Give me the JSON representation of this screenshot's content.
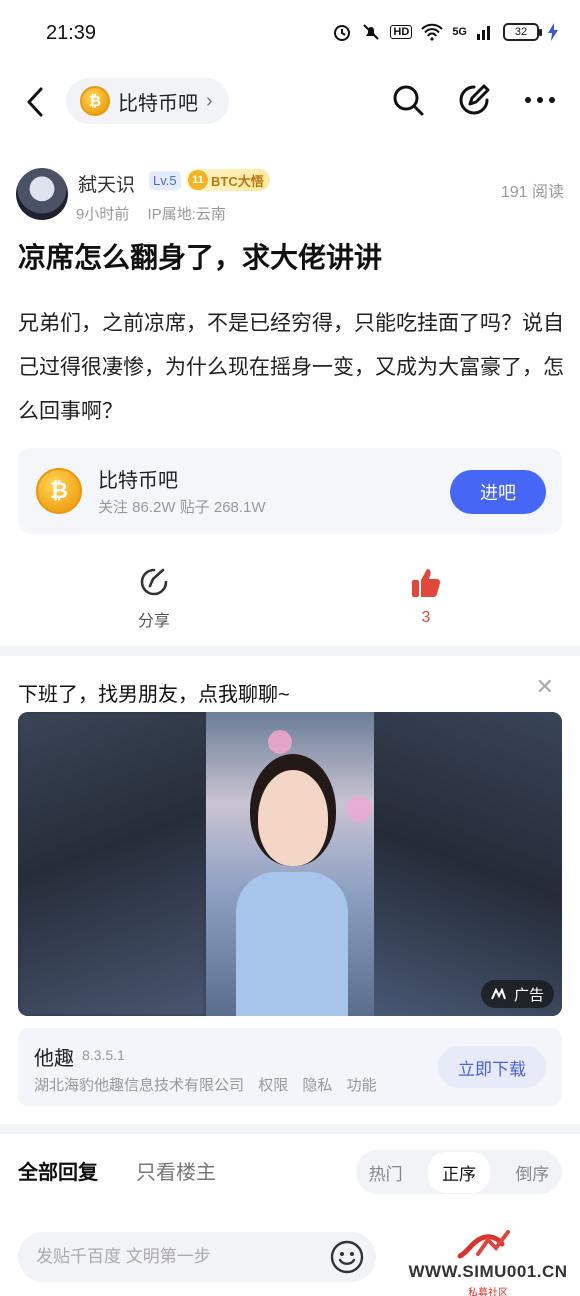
{
  "status_bar": {
    "time": "21:39",
    "network": "5G",
    "battery": "32",
    "hd": "HD"
  },
  "nav": {
    "forum_name": "比特币吧",
    "coin_symbol": "₿"
  },
  "post": {
    "author": "弑天识",
    "level": "Lv.5",
    "badge_number": "11",
    "badge_label": "BTC大悟",
    "time_ago": "9小时前",
    "ip_location": "IP属地:云南",
    "read_count": "191 阅读",
    "title": "凉席怎么翻身了，求大佬讲讲",
    "body": "兄弟们，之前凉席，不是已经穷得，只能吃挂面了吗？说自己过得很凄惨，为什么现在摇身一变，又成为大富豪了，怎么回事啊？"
  },
  "forum_card": {
    "name": "比特币吧",
    "stats": "关注 86.2W  贴子 268.1W",
    "join_label": "进吧"
  },
  "actions": {
    "share_label": "分享",
    "like_count": "3"
  },
  "ad": {
    "title": "下班了，找男朋友，点我聊聊~",
    "tag": "广告",
    "app_name": "他趣",
    "app_version": "8.3.5.1",
    "company": "湖北海豹他趣信息技术有限公司",
    "links": [
      "权限",
      "隐私",
      "功能"
    ],
    "download_label": "立即下载"
  },
  "replies": {
    "tab_all": "全部回复",
    "tab_op": "只看楼主",
    "sort": [
      "热门",
      "正序",
      "倒序"
    ]
  },
  "bottom": {
    "placeholder": "发贴千百度 文明第一步",
    "watermark_url": "WWW.SIMU001.CN",
    "watermark_sub": "私募社区"
  },
  "colors": {
    "accent_blue": "#4666f6",
    "like_red": "#e2473b",
    "coin_gold": "#f2a417"
  }
}
